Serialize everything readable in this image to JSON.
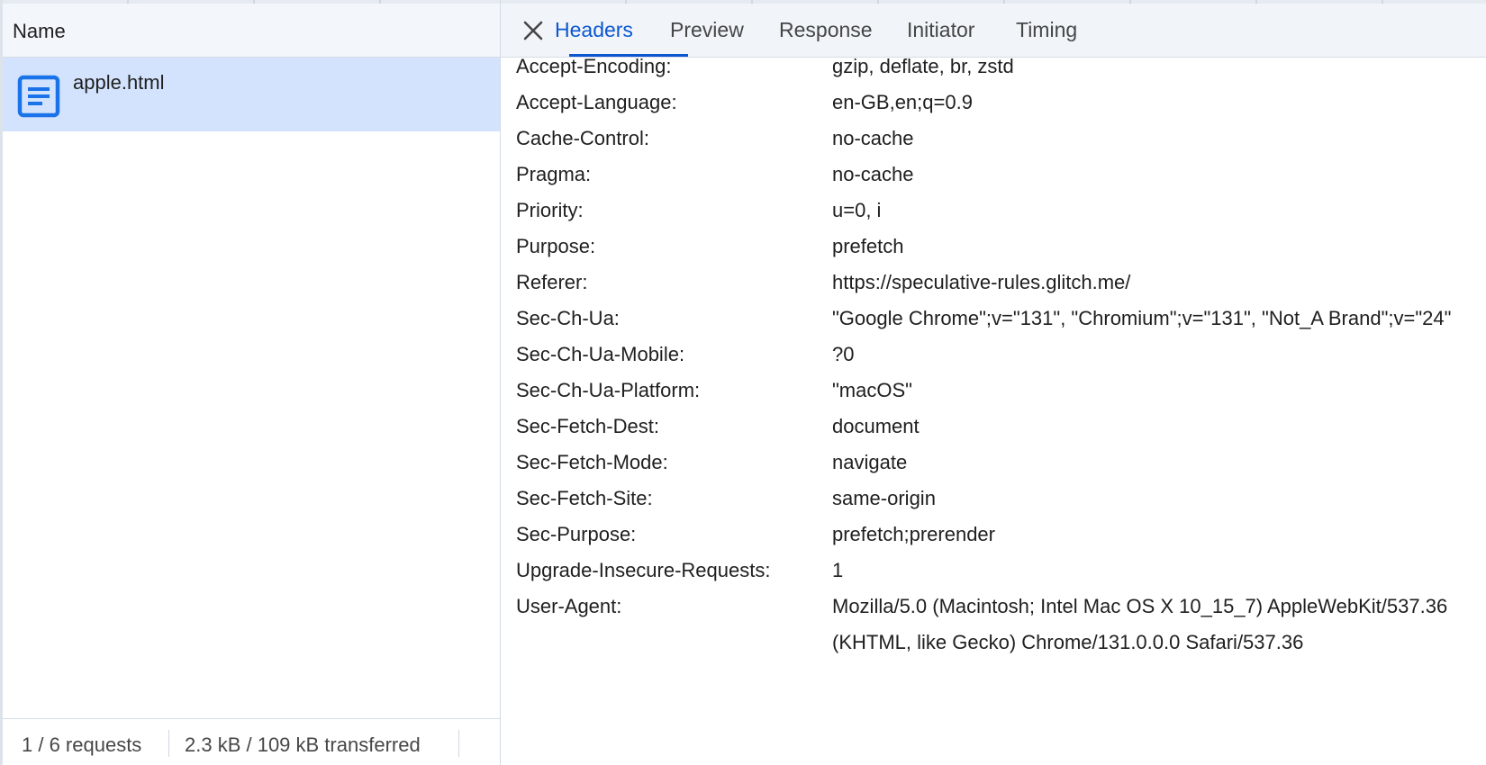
{
  "requests_panel": {
    "column_name": "Name",
    "selected_request": {
      "filename": "apple.html",
      "icon": "document-icon"
    },
    "footer": {
      "requests": "1 / 6 requests",
      "transferred": "2.3 kB / 109 kB transferred"
    }
  },
  "details_panel": {
    "close_icon": "close-icon",
    "tabs": [
      {
        "label": "Headers",
        "active": true
      },
      {
        "label": "Preview",
        "active": false
      },
      {
        "label": "Response",
        "active": false
      },
      {
        "label": "Initiator",
        "active": false
      },
      {
        "label": "Timing",
        "active": false
      }
    ],
    "request_headers": [
      {
        "name": "Accept-Encoding:",
        "value": "gzip, deflate, br, zstd"
      },
      {
        "name": "Accept-Language:",
        "value": "en-GB,en;q=0.9"
      },
      {
        "name": "Cache-Control:",
        "value": "no-cache"
      },
      {
        "name": "Pragma:",
        "value": "no-cache"
      },
      {
        "name": "Priority:",
        "value": "u=0, i"
      },
      {
        "name": "Purpose:",
        "value": "prefetch"
      },
      {
        "name": "Referer:",
        "value": "https://speculative-rules.glitch.me/"
      },
      {
        "name": "Sec-Ch-Ua:",
        "value": "\"Google Chrome\";v=\"131\", \"Chromium\";v=\"131\", \"Not_A Brand\";v=\"24\""
      },
      {
        "name": "Sec-Ch-Ua-Mobile:",
        "value": "?0"
      },
      {
        "name": "Sec-Ch-Ua-Platform:",
        "value": "\"macOS\""
      },
      {
        "name": "Sec-Fetch-Dest:",
        "value": "document"
      },
      {
        "name": "Sec-Fetch-Mode:",
        "value": "navigate"
      },
      {
        "name": "Sec-Fetch-Site:",
        "value": "same-origin"
      },
      {
        "name": "Sec-Purpose:",
        "value": "prefetch;prerender"
      },
      {
        "name": "Upgrade-Insecure-Requests:",
        "value": "1"
      },
      {
        "name": "User-Agent:",
        "value": "Mozilla/5.0 (Macintosh; Intel Mac OS X 10_15_7) AppleWebKit/537.36 (KHTML, like Gecko) Chrome/131.0.0.0 Safari/537.36"
      }
    ]
  },
  "colors": {
    "accent": "#0b57d0",
    "selected_row": "#d3e3fd",
    "header_bg": "#f1f4f9",
    "icon_blue": "#1a73e8"
  }
}
